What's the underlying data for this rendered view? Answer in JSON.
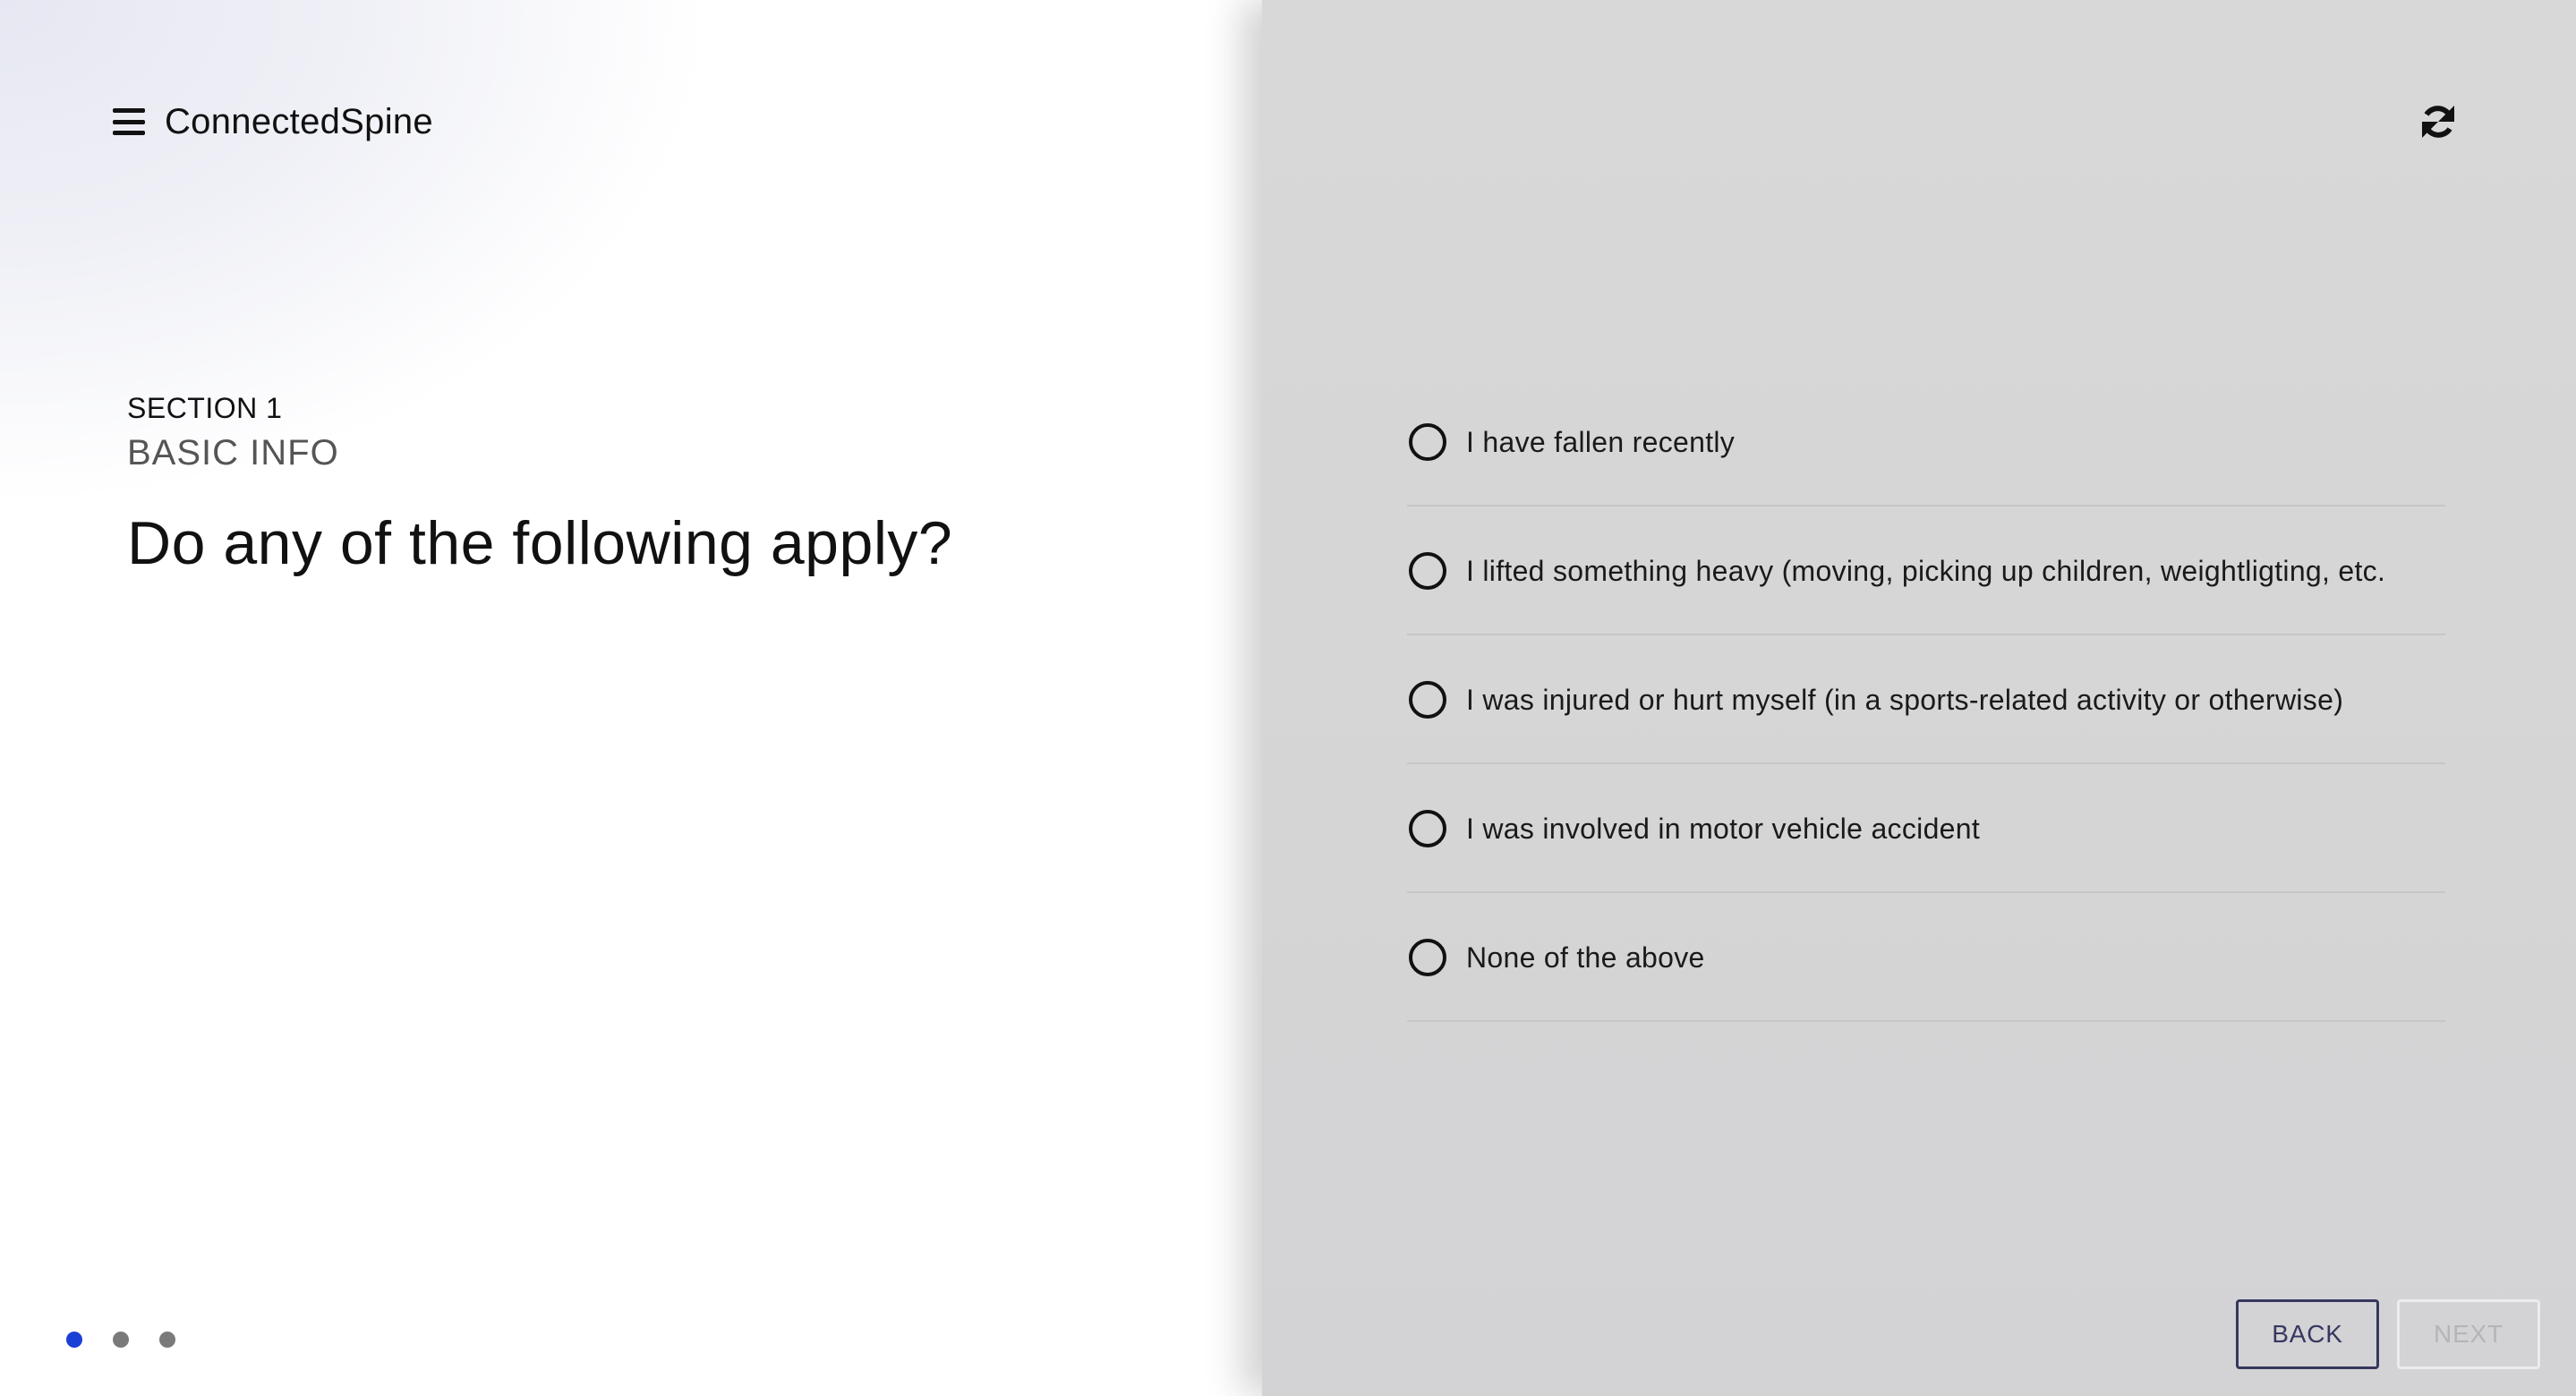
{
  "app": {
    "brand_name": "ConnectedSpine"
  },
  "section": {
    "label": "SECTION 1",
    "title": "BASIC INFO"
  },
  "question": {
    "text": "Do any of the following apply?"
  },
  "options": [
    {
      "label": "I have fallen recently",
      "selected": false
    },
    {
      "label": "I lifted something heavy (moving, picking up children, weightligting, etc.",
      "selected": false
    },
    {
      "label": "I was injured or hurt myself (in a sports-related activity or otherwise)",
      "selected": false
    },
    {
      "label": "I was involved in motor vehicle accident",
      "selected": false
    },
    {
      "label": "None of the above",
      "selected": false
    }
  ],
  "navigation": {
    "back_label": "BACK",
    "next_label": "NEXT",
    "next_enabled": false
  },
  "pager": {
    "total": 3,
    "active_index": 0
  },
  "colors": {
    "accent_dot": "#1a3fd6",
    "back_button": "#36385f",
    "panel_gray": "#d8d8d8"
  },
  "icons": {
    "menu": "hamburger-icon",
    "refresh": "refresh-icon"
  }
}
